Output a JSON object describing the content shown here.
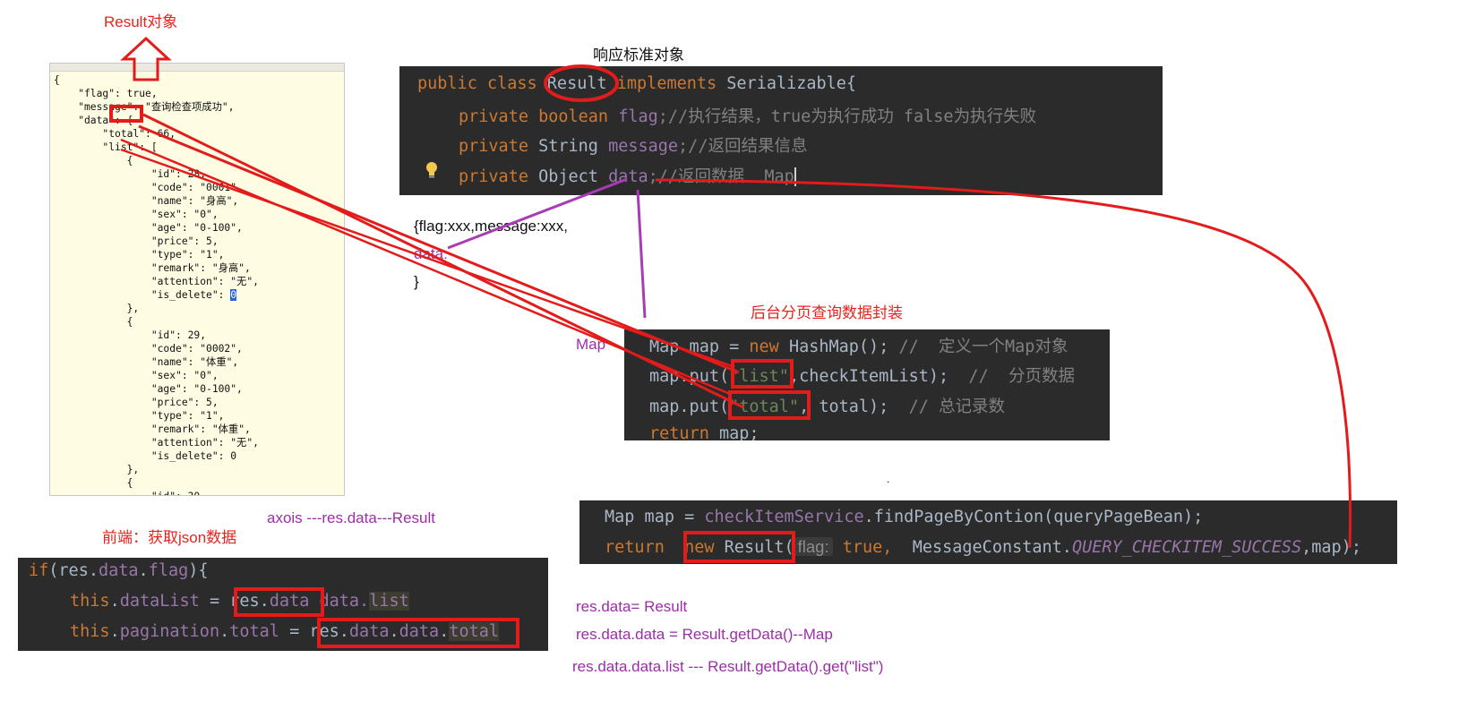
{
  "labels": {
    "result_object": "Result对象",
    "response_standard": "响应标准对象",
    "backend_paging": "后台分页查询数据封装",
    "frontend_fetch": "前端：获取json数据",
    "axios_chain": "axois ---res.data---Result",
    "map_label": "Map",
    "dot": ".",
    "json_shape": [
      "{flag:xxx,message:xxx,",
      "data:",
      "}"
    ],
    "res_data_result": "res.data= Result",
    "res_data_data": "res.data.data = Result.getData()--Map",
    "res_data_data_list": "res.data.data.list  --- Result.getData().get(\"list\")"
  },
  "json_lines": [
    "{",
    "    \"flag\": true,",
    "    \"message\": \"查询检查项成功\",",
    "    \"data\": {",
    "        \"total\": 66,",
    "        \"list\": [",
    "            {",
    "                \"id\": 28,",
    "                \"code\": \"0001\",",
    "                \"name\": \"身高\",",
    "                \"sex\": \"0\",",
    "                \"age\": \"0-100\",",
    "                \"price\": 5,",
    "                \"type\": \"1\",",
    "                \"remark\": \"身高\",",
    "                \"attention\": \"无\",",
    "                \"is_delete\": 0",
    "            },",
    "            {",
    "                \"id\": 29,",
    "                \"code\": \"0002\",",
    "                \"name\": \"体重\",",
    "                \"sex\": \"0\",",
    "                \"age\": \"0-100\",",
    "                \"price\": 5,",
    "                \"type\": \"1\",",
    "                \"remark\": \"体重\",",
    "                \"attention\": \"无\",",
    "                \"is_delete\": 0",
    "            },",
    "            {",
    "                \"id\": 30"
  ],
  "result_class": {
    "l1": {
      "a": "public class ",
      "b": "Result",
      "c": " implements ",
      "d": "Serializable{"
    },
    "l2": {
      "a": "private boolean ",
      "b": "flag",
      "c": ";//执行结果，true为执行成功 false为执行失败"
    },
    "l3": {
      "a": "private ",
      "b": "String ",
      "c": "message",
      "d": ";//返回结果信息"
    },
    "l4": {
      "a": "private ",
      "b": "Object ",
      "c": "data",
      "d": ";//返回数据  Map"
    }
  },
  "map_code": {
    "l1": {
      "a": "Map map = ",
      "b": "new ",
      "c": "HashMap(); ",
      "d": "//  定义一个Map对象"
    },
    "l2": {
      "a": "map.put(",
      "b": "\"list\"",
      "c": ",checkItemList); ",
      "d": " //  分页数据"
    },
    "l3": {
      "a": "map.put(",
      "b": "\"total\"",
      "c": ", total); ",
      "d": " // 总记录数"
    },
    "l4": {
      "a": "return ",
      "b": "map;"
    }
  },
  "service_code": {
    "l1": {
      "a": "Map map = ",
      "b": "checkItemService",
      "c": ".findPageByContion(queryPageBean);"
    },
    "l2": {
      "a": "return  ",
      "b": "new ",
      "c": "Result(",
      "d": "flag:",
      "e": " true, ",
      "f": " MessageConstant.",
      "g": "QUERY_CHECKITEM_SUCCESS",
      "h": ",map);"
    }
  },
  "frontend_code": {
    "l1": {
      "a": "if",
      "b": "(res.",
      "c": "data",
      "d": ".",
      "e": "flag",
      "f": "){"
    },
    "l2": {
      "a": "this",
      "b": ".",
      "c": "dataList",
      "d": " = ",
      "e": "res.",
      "f": "data",
      "g": " data.",
      "h": "list"
    },
    "l3": {
      "a": "this",
      "b": ".",
      "c": "pagination",
      "d": ".",
      "e": "total",
      "f": " = ",
      "g": "res.",
      "h": "data",
      "i": ".",
      "j": "data",
      "k": ".",
      "l": "total"
    }
  },
  "colors": {
    "annotation_red": "#e31b1b",
    "annotation_purple": "#9b2fa8",
    "code_bg": "#2b2b2b",
    "json_bg": "#fefde3"
  },
  "icons": {
    "hollow_up_arrow": "up-arrow-icon",
    "lightbulb": "lightbulb-icon"
  }
}
